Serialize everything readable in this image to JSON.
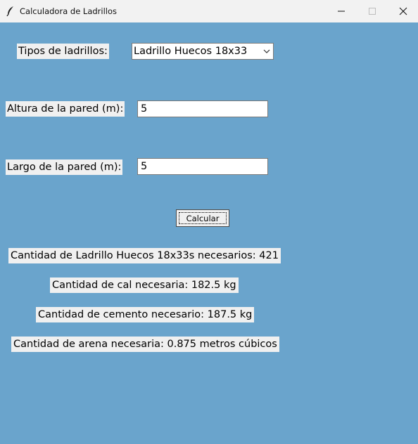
{
  "window": {
    "title": "Calculadora de Ladrillos"
  },
  "form": {
    "brick_type_label": "Tipos de ladrillos:",
    "brick_type_value": "Ladrillo Huecos 18x33",
    "height_label": "Altura de la pared (m):",
    "height_value": "5",
    "length_label": "Largo de la pared (m):",
    "length_value": "5",
    "calculate_button": "Calcular"
  },
  "results": {
    "bricks": "Cantidad de Ladrillo Huecos 18x33s necesarios: 421",
    "lime": "Cantidad de cal necesaria: 182.5 kg",
    "cement": "Cantidad de cemento necesario: 187.5 kg",
    "sand": "Cantidad de arena necesaria: 0.875 metros cúbicos"
  },
  "colors": {
    "background": "#6aa4cc",
    "label_background": "#f0f0f0",
    "titlebar": "#f2f2f2"
  }
}
